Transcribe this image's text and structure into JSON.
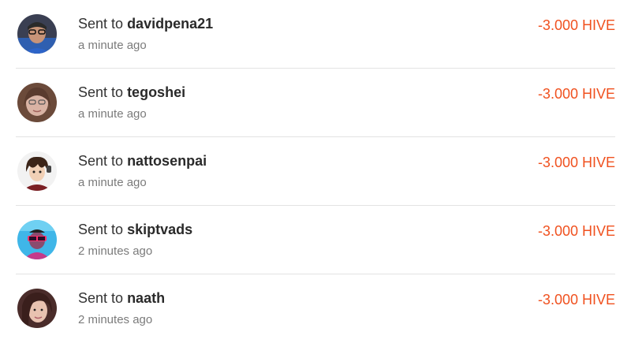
{
  "colors": {
    "amount": "#f0511f",
    "divider": "#e3e3e3",
    "secondary_text": "#7b7b7b"
  },
  "transactions": [
    {
      "prefix": "Sent to",
      "user": "davidpena21",
      "time": "a minute ago",
      "amount": "-3.000 HIVE",
      "avatar": "avatar-icon"
    },
    {
      "prefix": "Sent to",
      "user": "tegoshei",
      "time": "a minute ago",
      "amount": "-3.000 HIVE",
      "avatar": "avatar-icon"
    },
    {
      "prefix": "Sent to",
      "user": "nattosenpai",
      "time": "a minute ago",
      "amount": "-3.000 HIVE",
      "avatar": "avatar-icon"
    },
    {
      "prefix": "Sent to",
      "user": "skiptvads",
      "time": "2 minutes ago",
      "amount": "-3.000 HIVE",
      "avatar": "avatar-icon"
    },
    {
      "prefix": "Sent to",
      "user": "naath",
      "time": "2 minutes ago",
      "amount": "-3.000 HIVE",
      "avatar": "avatar-icon"
    }
  ]
}
